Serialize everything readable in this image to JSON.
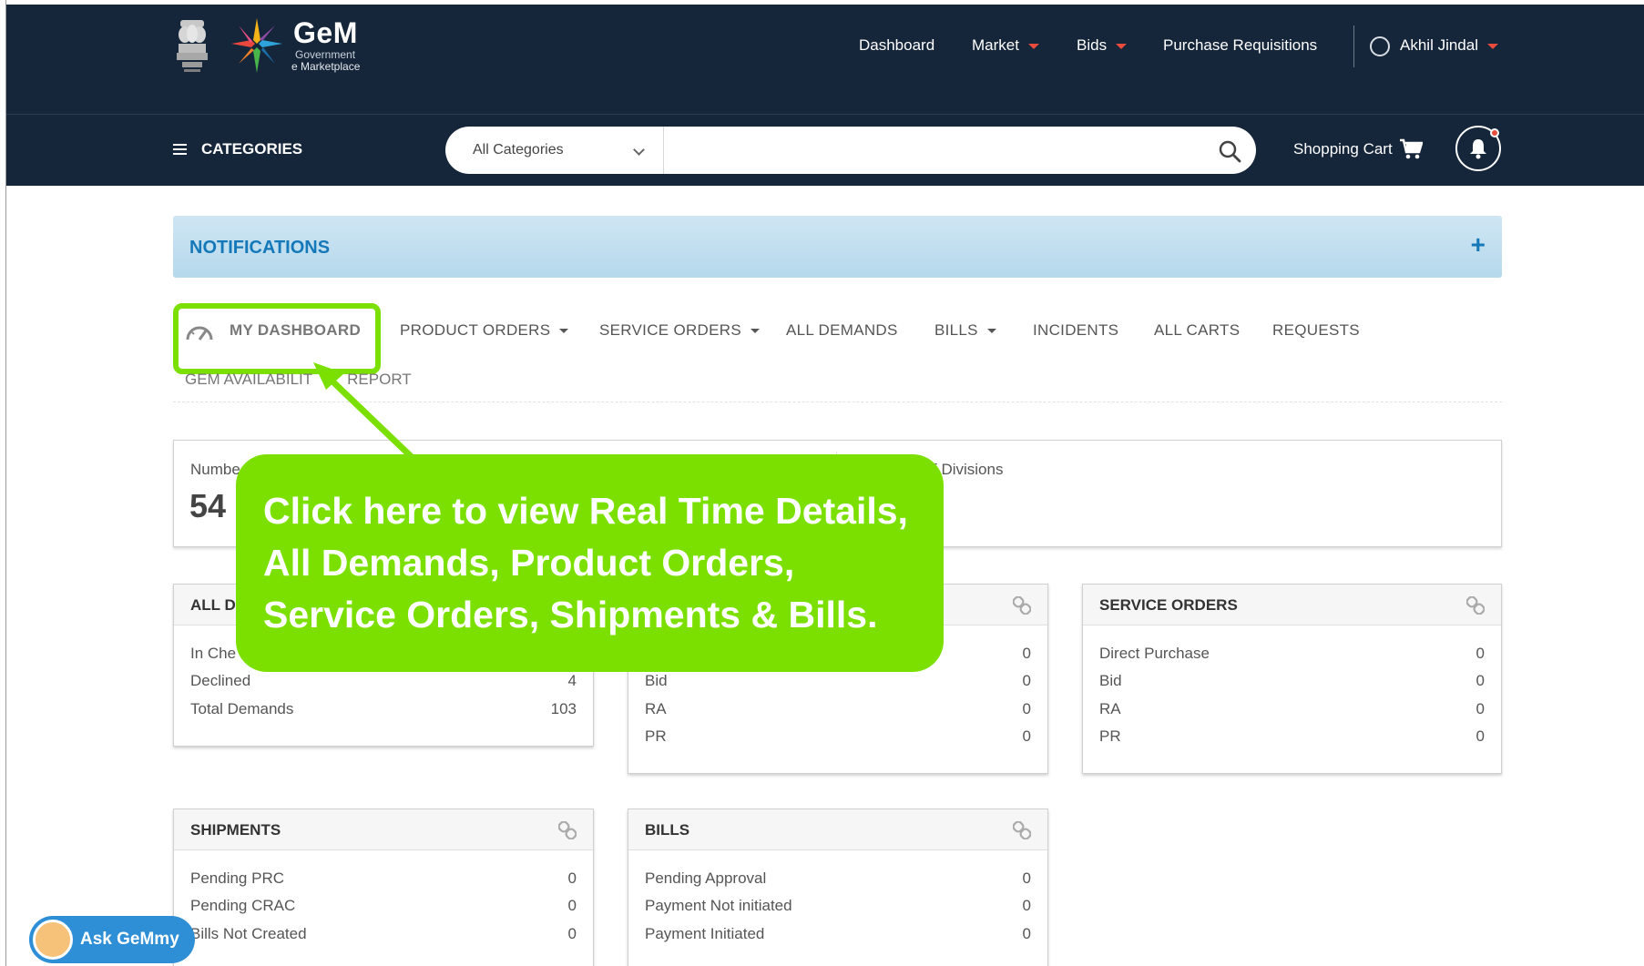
{
  "header": {
    "logo_text": "GeM",
    "logo_sub1": "Government",
    "logo_sub2": "e Marketplace",
    "nav": {
      "dashboard": "Dashboard",
      "market": "Market",
      "bids": "Bids",
      "purchase_requisitions": "Purchase Requisitions",
      "user": "Akhil Jindal"
    }
  },
  "subbar": {
    "categories_label": "CATEGORIES",
    "category_select": "All Categories",
    "search_placeholder": "",
    "cart_label": "Shopping Cart"
  },
  "notifications": {
    "title": "NOTIFICATIONS",
    "expand": "+"
  },
  "tabs": {
    "my_dashboard": "MY DASHBOARD",
    "product_orders": "PRODUCT ORDERS",
    "service_orders": "SERVICE ORDERS",
    "all_demands": "ALL DEMANDS",
    "bills": "BILLS",
    "incidents": "INCIDENTS",
    "all_carts": "ALL CARTS",
    "requests": "REQUESTS",
    "gem_availability": "GEM AVAILABILIT",
    "gem_availability_tail": "REPORT"
  },
  "stats": {
    "left_label": "Numbe",
    "left_value": "54",
    "right_label": "f Divisions"
  },
  "cards": {
    "all_demands": {
      "title": "ALL D",
      "rows": [
        {
          "label": "In Che",
          "value": ""
        },
        {
          "label": "Declined",
          "value": "4"
        },
        {
          "label": "Total Demands",
          "value": "103"
        }
      ]
    },
    "product_orders": {
      "rows": [
        {
          "label": "",
          "value": "0"
        },
        {
          "label": "Bid",
          "value": "0"
        },
        {
          "label": "RA",
          "value": "0"
        },
        {
          "label": "PR",
          "value": "0"
        }
      ]
    },
    "service_orders": {
      "title": "SERVICE ORDERS",
      "rows": [
        {
          "label": "Direct Purchase",
          "value": "0"
        },
        {
          "label": "Bid",
          "value": "0"
        },
        {
          "label": "RA",
          "value": "0"
        },
        {
          "label": "PR",
          "value": "0"
        }
      ]
    },
    "shipments": {
      "title": "SHIPMENTS",
      "rows": [
        {
          "label": "Pending PRC",
          "value": "0"
        },
        {
          "label": "Pending CRAC",
          "value": "0"
        },
        {
          "label": "Bills Not Created",
          "value": "0"
        }
      ]
    },
    "bills": {
      "title": "BILLS",
      "rows": [
        {
          "label": "Pending Approval",
          "value": "0"
        },
        {
          "label": "Payment Not initiated",
          "value": "0"
        },
        {
          "label": "Payment Initiated",
          "value": "0"
        }
      ]
    }
  },
  "callout": {
    "line1": "Click here to view Real Time Details,",
    "line2": "All Demands, Product Orders,",
    "line3": "Service Orders, Shipments & Bills."
  },
  "assistant": {
    "label": "Ask GeMmy"
  },
  "colors": {
    "header_bg": "#15253a",
    "accent_red": "#e84b3c",
    "notif_blue": "#1578b8",
    "callout_green": "#7be000",
    "gemmy_blue": "#2e8fd6"
  }
}
